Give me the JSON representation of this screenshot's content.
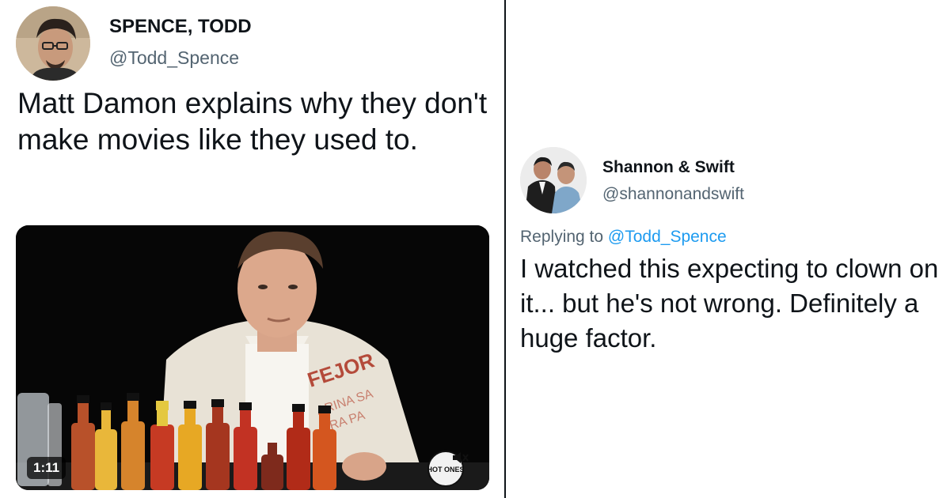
{
  "original_tweet": {
    "display_name": "SPENCE, TODD",
    "handle": "@Todd_Spence",
    "text": "Matt Damon explains why they don't make movies like they used to.",
    "video": {
      "duration": "1:11",
      "jacket_text_line1": "FEJOR",
      "jacket_text_line2": "ARINA SA",
      "jacket_text_line3": "ARA PA",
      "watermark_text": "HOT ONES"
    }
  },
  "reply_tweet": {
    "display_name": "Shannon & Swift",
    "handle": "@shannonandswift",
    "replying_prefix": "Replying to",
    "replying_mention": "@Todd_Spence",
    "text": "I watched this expecting to clown on it... but he's not wrong. Definitely a huge factor."
  },
  "colors": {
    "text_primary": "#0f1419",
    "text_secondary": "#536471",
    "link": "#1d9bf0",
    "divider": "#0f1419"
  }
}
